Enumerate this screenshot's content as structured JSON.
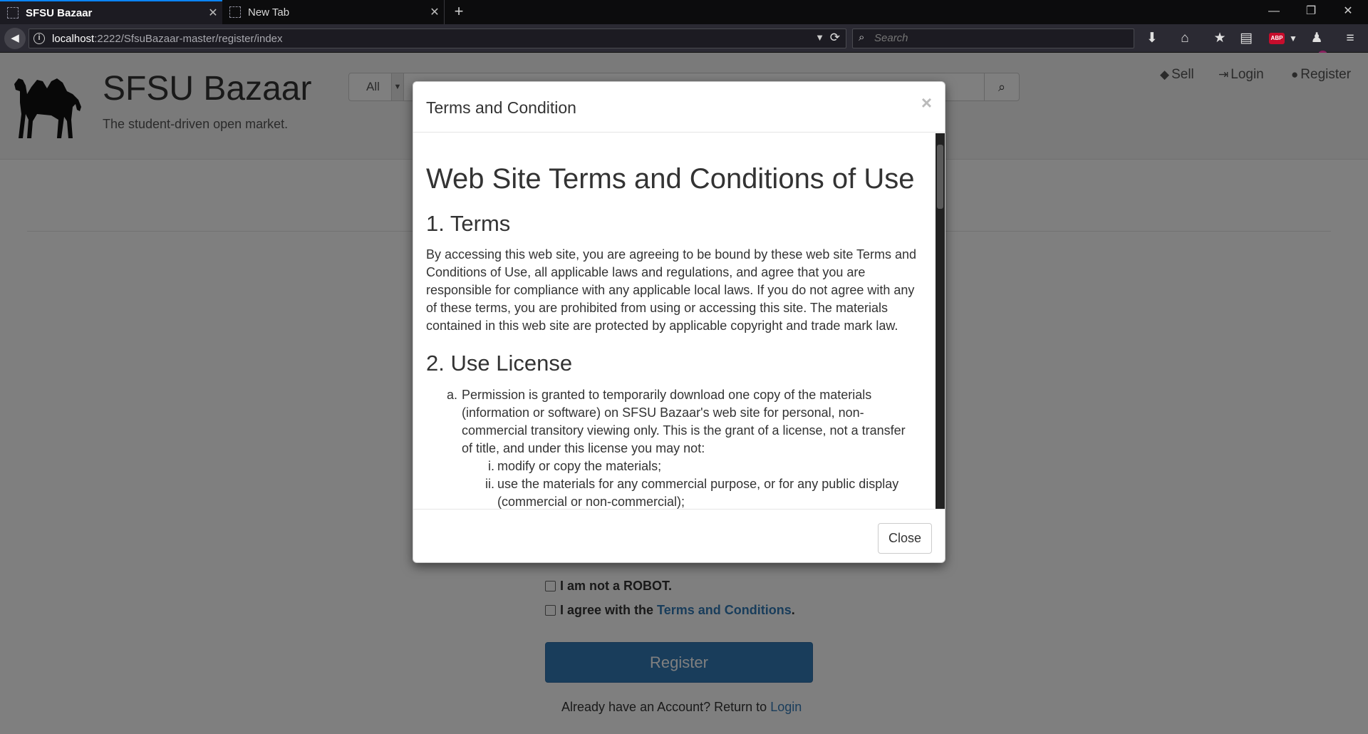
{
  "browser": {
    "tabs": [
      {
        "title": "SFSU Bazaar",
        "active": true
      },
      {
        "title": "New Tab",
        "active": false
      }
    ],
    "url_host": "localhost",
    "url_path": ":2222/SfsuBazaar-master/register/index",
    "search_placeholder": "Search",
    "notification_count": "0",
    "abp_label": "ABP"
  },
  "site": {
    "title": "SFSU Bazaar",
    "tagline": "The student-driven open market.",
    "category_selected": "All",
    "nav": {
      "sell": "Sell",
      "login": "Login",
      "register": "Register"
    }
  },
  "form": {
    "robot_label": "I am not a ROBOT.",
    "agree_prefix": "I agree with the",
    "agree_link": "Terms and Conditions",
    "agree_suffix": ".",
    "register_button": "Register",
    "account_prefix": "Already have an Account? Return to",
    "account_link": "Login"
  },
  "modal": {
    "title": "Terms and Condition",
    "close_x": "×",
    "heading": "Web Site Terms and Conditions of Use",
    "section1_title": "1. Terms",
    "section1_text": "By accessing this web site, you are agreeing to be bound by these web site Terms and Conditions of Use, all applicable laws and regulations, and agree that you are responsible for compliance with any applicable local laws. If you do not agree with any of these terms, you are prohibited from using or accessing this site. The materials contained in this web site are protected by applicable copyright and trade mark law.",
    "section2_title": "2. Use License",
    "license_a_marker": "a.",
    "license_a": "Permission is granted to temporarily download one copy of the materials (information or software) on SFSU Bazaar's web site for personal, non-commercial transitory viewing only. This is the grant of a license, not a transfer of title, and under this license you may not:",
    "license_i_marker": "i.",
    "license_i": "modify or copy the materials;",
    "license_ii_marker": "ii.",
    "license_ii": "use the materials for any commercial purpose, or for any public display (commercial or non-commercial);",
    "close_button": "Close"
  },
  "colors": {
    "link": "#337ab7",
    "primary_button": "#337ab7",
    "browser_chrome": "#0c0c0d",
    "header_bg": "#f5f5f5"
  },
  "icons": [
    "back-arrow-icon",
    "info-icon",
    "reload-icon",
    "search-icon",
    "download-icon",
    "home-icon",
    "bookmark-star-icon",
    "reader-icon",
    "adblock-icon",
    "notification-icon",
    "menu-icon",
    "tag-icon",
    "login-icon",
    "user-icon",
    "camel-logo"
  ]
}
